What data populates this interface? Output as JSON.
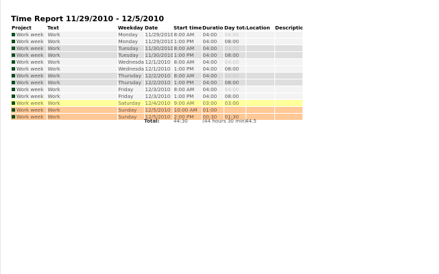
{
  "report": {
    "title": "Time Report 11/29/2010 - 12/5/2010",
    "columns": [
      "Project",
      "Text",
      "Weekday",
      "Date",
      "Start time",
      "Duration",
      "Day total",
      "Location",
      "Description"
    ],
    "rows": [
      {
        "style": "light",
        "project": "Work week",
        "text": "Work",
        "weekday": "Monday",
        "date": "11/29/2010",
        "start": "8:00 AM",
        "duration": "04:00",
        "day_total": "04:00",
        "day_total_dim": true,
        "location": "",
        "description": ""
      },
      {
        "style": "light",
        "project": "Work week",
        "text": "Work",
        "weekday": "Monday",
        "date": "11/29/2010",
        "start": "1:00 PM",
        "duration": "04:00",
        "day_total": "08:00",
        "day_total_dim": false,
        "location": "",
        "description": ""
      },
      {
        "style": "dark",
        "project": "Work week",
        "text": "Work",
        "weekday": "Tuesday",
        "date": "11/30/2010",
        "start": "8:00 AM",
        "duration": "04:00",
        "day_total": "04:00",
        "day_total_dim": true,
        "location": "",
        "description": ""
      },
      {
        "style": "dark",
        "project": "Work week",
        "text": "Work",
        "weekday": "Tuesday",
        "date": "11/30/2010",
        "start": "1:00 PM",
        "duration": "04:00",
        "day_total": "08:00",
        "day_total_dim": false,
        "location": "",
        "description": ""
      },
      {
        "style": "light",
        "project": "Work week",
        "text": "Work",
        "weekday": "Wednesday",
        "date": "12/1/2010",
        "start": "8:00 AM",
        "duration": "04:00",
        "day_total": "04:00",
        "day_total_dim": true,
        "location": "",
        "description": ""
      },
      {
        "style": "light",
        "project": "Work week",
        "text": "Work",
        "weekday": "Wednesday",
        "date": "12/1/2010",
        "start": "1:00 PM",
        "duration": "04:00",
        "day_total": "08:00",
        "day_total_dim": false,
        "location": "",
        "description": ""
      },
      {
        "style": "dark",
        "project": "Work week",
        "text": "Work",
        "weekday": "Thursday",
        "date": "12/2/2010",
        "start": "8:00 AM",
        "duration": "04:00",
        "day_total": "04:00",
        "day_total_dim": true,
        "location": "",
        "description": ""
      },
      {
        "style": "dark",
        "project": "Work week",
        "text": "Work",
        "weekday": "Thursday",
        "date": "12/2/2010",
        "start": "1:00 PM",
        "duration": "04:00",
        "day_total": "08:00",
        "day_total_dim": false,
        "location": "",
        "description": ""
      },
      {
        "style": "light",
        "project": "Work week",
        "text": "Work",
        "weekday": "Friday",
        "date": "12/3/2010",
        "start": "8:00 AM",
        "duration": "04:00",
        "day_total": "04:00",
        "day_total_dim": true,
        "location": "",
        "description": ""
      },
      {
        "style": "light",
        "project": "Work week",
        "text": "Work",
        "weekday": "Friday",
        "date": "12/3/2010",
        "start": "1:00 PM",
        "duration": "04:00",
        "day_total": "08:00",
        "day_total_dim": false,
        "location": "",
        "description": ""
      },
      {
        "style": "yellow",
        "project": "Work week",
        "text": "Work",
        "weekday": "Saturday",
        "date": "12/4/2010",
        "start": "9:00 AM",
        "duration": "03:00",
        "day_total": "03:00",
        "day_total_dim": false,
        "location": "",
        "description": ""
      },
      {
        "style": "orange",
        "project": "Work week",
        "text": "Work",
        "weekday": "Sunday",
        "date": "12/5/2010",
        "start": "10:00 AM",
        "duration": "01:00",
        "day_total": "",
        "day_total_dim": false,
        "location": "",
        "description": ""
      },
      {
        "style": "orange",
        "project": "Work week",
        "text": "Work",
        "weekday": "Sunday",
        "date": "12/5/2010",
        "start": "2:00 PM",
        "duration": "00:30",
        "day_total": "01:30",
        "day_total_dim": false,
        "location": "",
        "description": ""
      }
    ],
    "totals": {
      "label": "Total:",
      "duration": "44:30",
      "verbose": "(44 hours 30 min)",
      "decimal": "44.5"
    }
  },
  "colors": {
    "row_light": "#f3f3f3",
    "row_dark": "#dedede",
    "row_saturday": "#ffff99",
    "row_sunday": "#ffc896",
    "project_marker": "#0b4d1f"
  }
}
